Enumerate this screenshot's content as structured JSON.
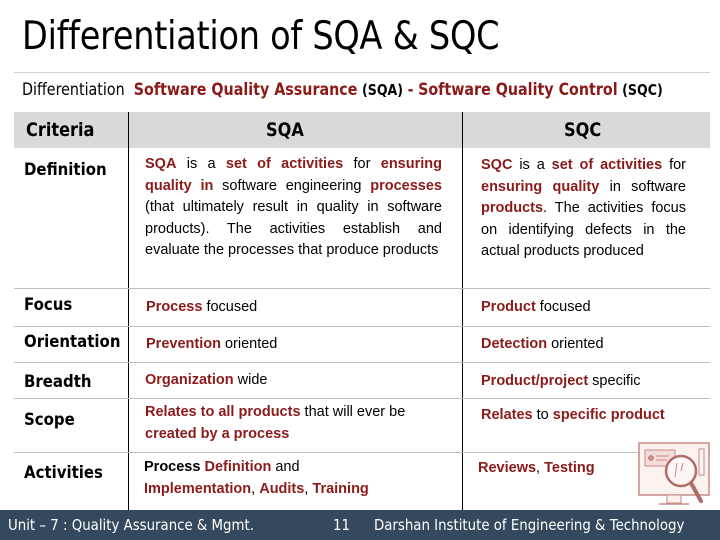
{
  "slide": {
    "title": "Differentiation of SQA & SQC",
    "subtitle": {
      "lead": "Differentiation",
      "sqa_full": "Software Quality Assurance",
      "sqa_abbr": "(SQA)",
      "dash": "-",
      "sqc_full": "Software Quality Control",
      "sqc_abbr": "(SQC)"
    },
    "accent_color": "#8b1a1a",
    "footer_color": "#34485e"
  },
  "table": {
    "headers": {
      "criteria": "Criteria",
      "sqa": "SQA",
      "sqc": "SQC"
    },
    "rows": [
      {
        "criteria": "Definition",
        "sqa": [
          {
            "t": "SQA",
            "hl": true
          },
          {
            "t": " is a "
          },
          {
            "t": "set of activities",
            "hl": true
          },
          {
            "t": " for "
          },
          {
            "t": "ensuring quality in",
            "hl": true
          },
          {
            "t": " software engineering "
          },
          {
            "t": "processes",
            "hl": true
          },
          {
            "t": " (that ultimately result in quality in software products). The activities establish and evaluate the processes that produce products"
          }
        ],
        "sqc": [
          {
            "t": "SQC",
            "hl": true
          },
          {
            "t": " is a "
          },
          {
            "t": "set of activities",
            "hl": true
          },
          {
            "t": " for "
          },
          {
            "t": "ensuring quality",
            "hl": true
          },
          {
            "t": " in software "
          },
          {
            "t": "products",
            "hl": true
          },
          {
            "t": ". The activities focus on identifying defects in the actual products produced"
          }
        ]
      },
      {
        "criteria": "Focus",
        "sqa": [
          {
            "t": "Process",
            "hl": true
          },
          {
            "t": " focused"
          }
        ],
        "sqc": [
          {
            "t": "Product",
            "hl": true
          },
          {
            "t": " focused"
          }
        ]
      },
      {
        "criteria": "Orientation",
        "sqa": [
          {
            "t": "Prevention",
            "hl": true
          },
          {
            "t": " oriented"
          }
        ],
        "sqc": [
          {
            "t": "Detection",
            "hl": true
          },
          {
            "t": " oriented"
          }
        ]
      },
      {
        "criteria": "Breadth",
        "sqa": [
          {
            "t": "Organization",
            "hl": true
          },
          {
            "t": " wide"
          }
        ],
        "sqc": [
          {
            "t": "Product/project",
            "hl": true
          },
          {
            "t": " specific"
          }
        ]
      },
      {
        "criteria": "Scope",
        "sqa": [
          {
            "t": "Relates to all products",
            "hl": true
          },
          {
            "t": " that will ever be "
          },
          {
            "t": "created by a process",
            "hl": true
          }
        ],
        "sqc": [
          {
            "t": "Relates",
            "hl": true
          },
          {
            "t": " to "
          },
          {
            "t": "specific product",
            "hl": true
          }
        ]
      },
      {
        "criteria": "Activities",
        "sqa": [
          {
            "t": "Process ",
            "bold": true
          },
          {
            "t": "Definition",
            "hl": true
          },
          {
            "t": " and "
          },
          {
            "t": "Implementation",
            "hl": true
          },
          {
            "t": ", "
          },
          {
            "t": "Audits",
            "hl": true
          },
          {
            "t": ", "
          },
          {
            "t": "Training",
            "hl": true
          }
        ],
        "sqc": [
          {
            "t": "Reviews",
            "hl": true
          },
          {
            "t": ", "
          },
          {
            "t": "Testing",
            "hl": true
          }
        ]
      }
    ]
  },
  "illustration": {
    "icon": "monitor-magnifier-icon"
  },
  "footer": {
    "unit": "Unit – 7 : Quality Assurance & Mgmt.",
    "page": "11",
    "institute": "Darshan Institute of Engineering & Technology"
  }
}
